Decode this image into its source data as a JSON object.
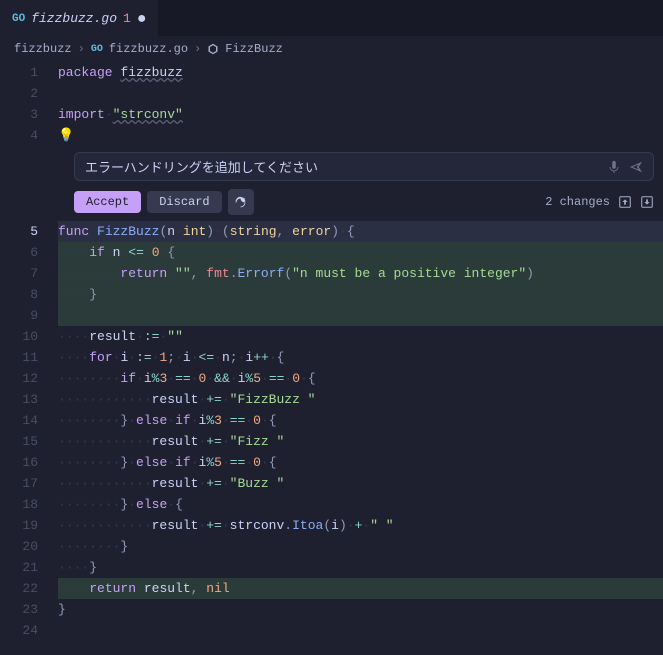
{
  "tab": {
    "filename": "fizzbuzz.go",
    "diag_count": "1"
  },
  "breadcrumb": {
    "folder": "fizzbuzz",
    "file": "fizzbuzz.go",
    "symbol": "FizzBuzz"
  },
  "ai": {
    "prompt": "エラーハンドリングを追加してください",
    "accept": "Accept",
    "discard": "Discard",
    "changes": "2 changes"
  },
  "code": {
    "l1_pkg": "package",
    "l1_name": "fizzbuzz",
    "l3_import": "import",
    "l3_lib": "\"strconv\"",
    "l5_func": "func",
    "l5_name": "FizzBuzz",
    "l5_param": "n",
    "l5_ptype": "int",
    "l5_ret1": "string",
    "l5_ret2": "error",
    "l6_if": "if",
    "l6_n": "n",
    "l6_op": "<=",
    "l6_zero": "0",
    "l7_return": "return",
    "l7_empty": "\"\"",
    "l7_fmt": "fmt",
    "l7_errorf": "Errorf",
    "l7_msg": "\"n must be a positive integer\"",
    "l10_result": "result",
    "l10_assign": ":=",
    "l10_empty": "\"\"",
    "l11_for": "for",
    "l11_i": "i",
    "l11_assign": ":=",
    "l11_one": "1",
    "l11_i2": "i",
    "l11_le": "<=",
    "l11_n": "n",
    "l11_i3": "i",
    "l11_inc": "++",
    "l12_if": "if",
    "l12_i": "i",
    "l12_mod": "%",
    "l12_three": "3",
    "l12_eq": "==",
    "l12_zero": "0",
    "l12_and": "&&",
    "l12_i2": "i",
    "l12_five": "5",
    "l12_zero2": "0",
    "l13_result": "result",
    "l13_pluseq": "+=",
    "l13_fizzbuzz": "\"FizzBuzz \"",
    "l14_else": "else",
    "l14_if": "if",
    "l14_i": "i",
    "l14_three": "3",
    "l14_zero": "0",
    "l15_result": "result",
    "l15_fizz": "\"Fizz \"",
    "l16_else": "else",
    "l16_if": "if",
    "l16_i": "i",
    "l16_five": "5",
    "l16_zero": "0",
    "l17_result": "result",
    "l17_buzz": "\"Buzz \"",
    "l18_else": "else",
    "l19_result": "result",
    "l19_strconv": "strconv",
    "l19_itoa": "Itoa",
    "l19_i": "i",
    "l19_plus": "+",
    "l19_space": "\" \"",
    "l22_return": "return",
    "l22_result": "result",
    "l22_nil": "nil"
  },
  "line_numbers": [
    "1",
    "2",
    "3",
    "4",
    "5",
    "6",
    "7",
    "8",
    "9",
    "10",
    "11",
    "12",
    "13",
    "14",
    "15",
    "16",
    "17",
    "18",
    "19",
    "20",
    "21",
    "22",
    "23",
    "24"
  ]
}
